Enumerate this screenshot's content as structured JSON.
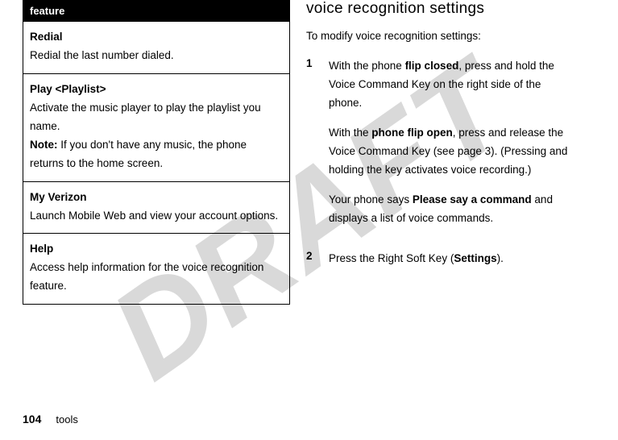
{
  "watermark": "DRAFT",
  "table": {
    "header": "feature",
    "rows": [
      {
        "title": "Redial",
        "desc": "Redial the last number dialed."
      },
      {
        "title": "Play <Playlist>",
        "desc": "Activate the music player to play the playlist you name.",
        "note_label": "Note:",
        "note": " If you don't have any music, the phone returns to the home screen."
      },
      {
        "title": "My Verizon",
        "desc": "Launch Mobile Web and view your account options."
      },
      {
        "title": "Help",
        "desc": "Access help information for the voice recognition feature."
      }
    ]
  },
  "right": {
    "heading": "voice recognition settings",
    "intro": "To modify voice recognition settings:",
    "steps": [
      {
        "num": "1",
        "p1_a": "With the phone ",
        "p1_bold": "flip closed",
        "p1_b": ", press and hold the Voice Command Key on the right side of the phone.",
        "p2_a": "With the ",
        "p2_bold": "phone flip open",
        "p2_b": ", press and release the Voice Command Key (see page 3). (Pressing and holding the key activates voice recording.)",
        "p3_a": "Your phone says ",
        "p3_cond": "Please say a command",
        "p3_b": " and displays a list of voice commands."
      },
      {
        "num": "2",
        "p1_a": "Press the Right Soft Key (",
        "p1_cond": "Settings",
        "p1_b": ")."
      }
    ]
  },
  "footer": {
    "page": "104",
    "section": "tools"
  }
}
